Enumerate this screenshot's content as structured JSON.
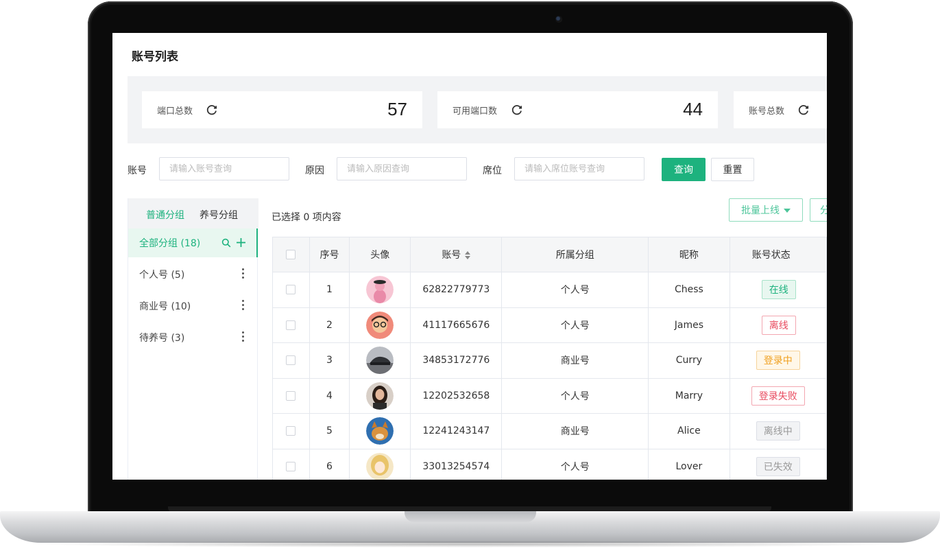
{
  "page": {
    "title": "账号列表"
  },
  "stats": [
    {
      "label": "端口总数",
      "value": "57"
    },
    {
      "label": "可用端口数",
      "value": "44"
    },
    {
      "label": "账号总数",
      "value": ""
    }
  ],
  "filters": {
    "account_label": "账号",
    "account_placeholder": "请输入账号查询",
    "reason_label": "原因",
    "reason_placeholder": "请输入原因查询",
    "seat_label": "席位",
    "seat_placeholder": "请输入席位账号查询",
    "query_button": "查询",
    "reset_button": "重置"
  },
  "side_panel": {
    "tabs": [
      "普通分组",
      "养号分组"
    ],
    "active_tab": "普通分组",
    "items": [
      {
        "label": "全部分组 (18)",
        "active": true
      },
      {
        "label": "个人号 (5)"
      },
      {
        "label": "商业号 (10)"
      },
      {
        "label": "待养号 (3)"
      }
    ]
  },
  "toolbar": {
    "selected_info": "已选择 0 项内容",
    "batch_online": "批量上线",
    "batch_second": "分"
  },
  "table": {
    "columns": [
      "",
      "序号",
      "头像",
      "账号",
      "所属分组",
      "昵称",
      "账号状态"
    ],
    "rows": [
      {
        "index": "1",
        "account": "62822779773",
        "group": "个人号",
        "nickname": "Chess",
        "status": "在线",
        "status_type": "online"
      },
      {
        "index": "2",
        "account": "41117665676",
        "group": "个人号",
        "nickname": "James",
        "status": "离线",
        "status_type": "offline"
      },
      {
        "index": "3",
        "account": "34853172776",
        "group": "商业号",
        "nickname": "Curry",
        "status": "登录中",
        "status_type": "logging"
      },
      {
        "index": "4",
        "account": "12202532658",
        "group": "个人号",
        "nickname": "Marry",
        "status": "登录失败",
        "status_type": "failed"
      },
      {
        "index": "5",
        "account": "12241243147",
        "group": "商业号",
        "nickname": "Alice",
        "status": "离线中",
        "status_type": "going-off"
      },
      {
        "index": "6",
        "account": "33013254574",
        "group": "个人号",
        "nickname": "Lover",
        "status": "已失效",
        "status_type": "expired"
      }
    ]
  },
  "colors": {
    "primary": "#1db27e",
    "danger": "#e84b5f",
    "warning": "#f0a020",
    "muted": "#999999"
  },
  "icons": [
    "refresh-icon",
    "search-icon",
    "plus-icon",
    "more-icon",
    "sort-icon",
    "dropdown-caret-icon",
    "camera"
  ]
}
